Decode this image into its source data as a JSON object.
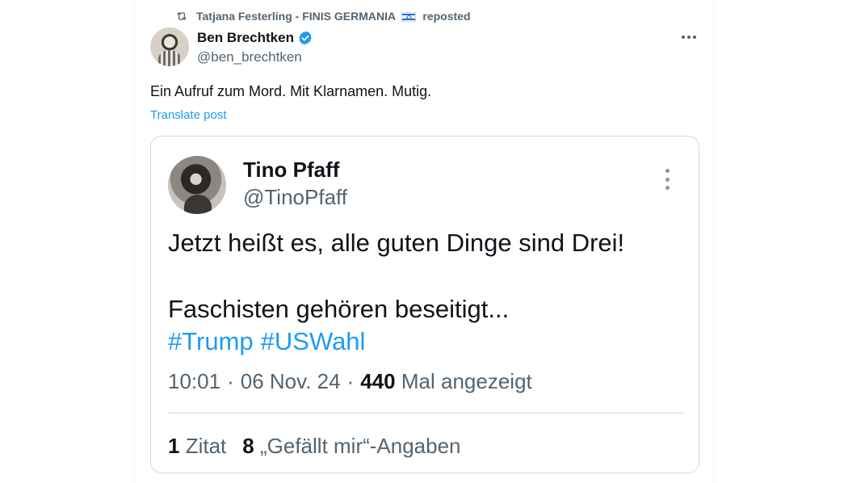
{
  "repost": {
    "reposter": "Tatjana Festerling - FINIS GERMANIA",
    "flag": "🇮🇱",
    "suffix": "reposted"
  },
  "post": {
    "display_name": "Ben Brechtken",
    "handle": "@ben_brechtken",
    "text": "Ein Aufruf zum Mord. Mit Klarnamen. Mutig.",
    "translate_label": "Translate post"
  },
  "embedded": {
    "display_name": "Tino Pfaff",
    "handle": "@TinoPfaff",
    "line1": "Jetzt heißt es, alle guten Dinge sind Drei!",
    "line2": "Faschisten gehören beseitigt...",
    "hashtags": [
      "#Trump",
      "#USWahl"
    ],
    "time": "10:01",
    "date": "06 Nov. 24",
    "views_count": "440",
    "views_label": "Mal angezeigt",
    "quotes_count": "1",
    "quotes_label": "Zitat",
    "likes_count": "8",
    "likes_label": "„Gefällt mir“-Angaben"
  },
  "colors": {
    "link": "#1d9bf0",
    "muted": "#536471",
    "verified": "#1d9bf0"
  }
}
